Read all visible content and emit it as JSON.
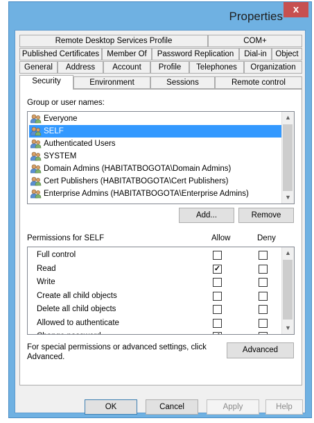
{
  "window": {
    "title": "Properties",
    "close_glyph": "x"
  },
  "tabs": {
    "row1": [
      "Remote Desktop Services Profile",
      "COM+"
    ],
    "row2": [
      "Published Certificates",
      "Member Of",
      "Password Replication",
      "Dial-in",
      "Object"
    ],
    "row3": [
      "General",
      "Address",
      "Account",
      "Profile",
      "Telephones",
      "Organization"
    ],
    "row4": [
      "Security",
      "Environment",
      "Sessions",
      "Remote control"
    ],
    "active": "Security"
  },
  "security": {
    "group_label": "Group or user names:",
    "users": [
      {
        "name": "Everyone",
        "icon": "users-icon"
      },
      {
        "name": "SELF",
        "icon": "users-icon",
        "selected": true
      },
      {
        "name": "Authenticated Users",
        "icon": "users-icon"
      },
      {
        "name": "SYSTEM",
        "icon": "users-icon"
      },
      {
        "name": "Domain Admins (HABITATBOGOTA\\Domain Admins)",
        "icon": "users-icon"
      },
      {
        "name": "Cert Publishers (HABITATBOGOTA\\Cert Publishers)",
        "icon": "users-icon"
      },
      {
        "name": "Enterprise Admins (HABITATBOGOTA\\Enterprise Admins)",
        "icon": "users-icon"
      }
    ],
    "add_label": "Add...",
    "remove_label": "Remove",
    "permissions_label": "Permissions for SELF",
    "allow_label": "Allow",
    "deny_label": "Deny",
    "permissions": [
      {
        "name": "Full control",
        "allow": false,
        "deny": false
      },
      {
        "name": "Read",
        "allow": true,
        "deny": false
      },
      {
        "name": "Write",
        "allow": false,
        "deny": false
      },
      {
        "name": "Create all child objects",
        "allow": false,
        "deny": false
      },
      {
        "name": "Delete all child objects",
        "allow": false,
        "deny": false
      },
      {
        "name": "Allowed to authenticate",
        "allow": false,
        "deny": false
      },
      {
        "name": "Change password",
        "allow": true,
        "deny": false
      }
    ],
    "special_text_1": "For special permissions or advanced settings, click",
    "special_text_2": "Advanced.",
    "advanced_label": "Advanced"
  },
  "footer": {
    "ok": "OK",
    "cancel": "Cancel",
    "apply": "Apply",
    "help": "Help"
  },
  "colors": {
    "title_bar": "#6fb1e2",
    "selection": "#3399ff",
    "close_button": "#c75050"
  }
}
